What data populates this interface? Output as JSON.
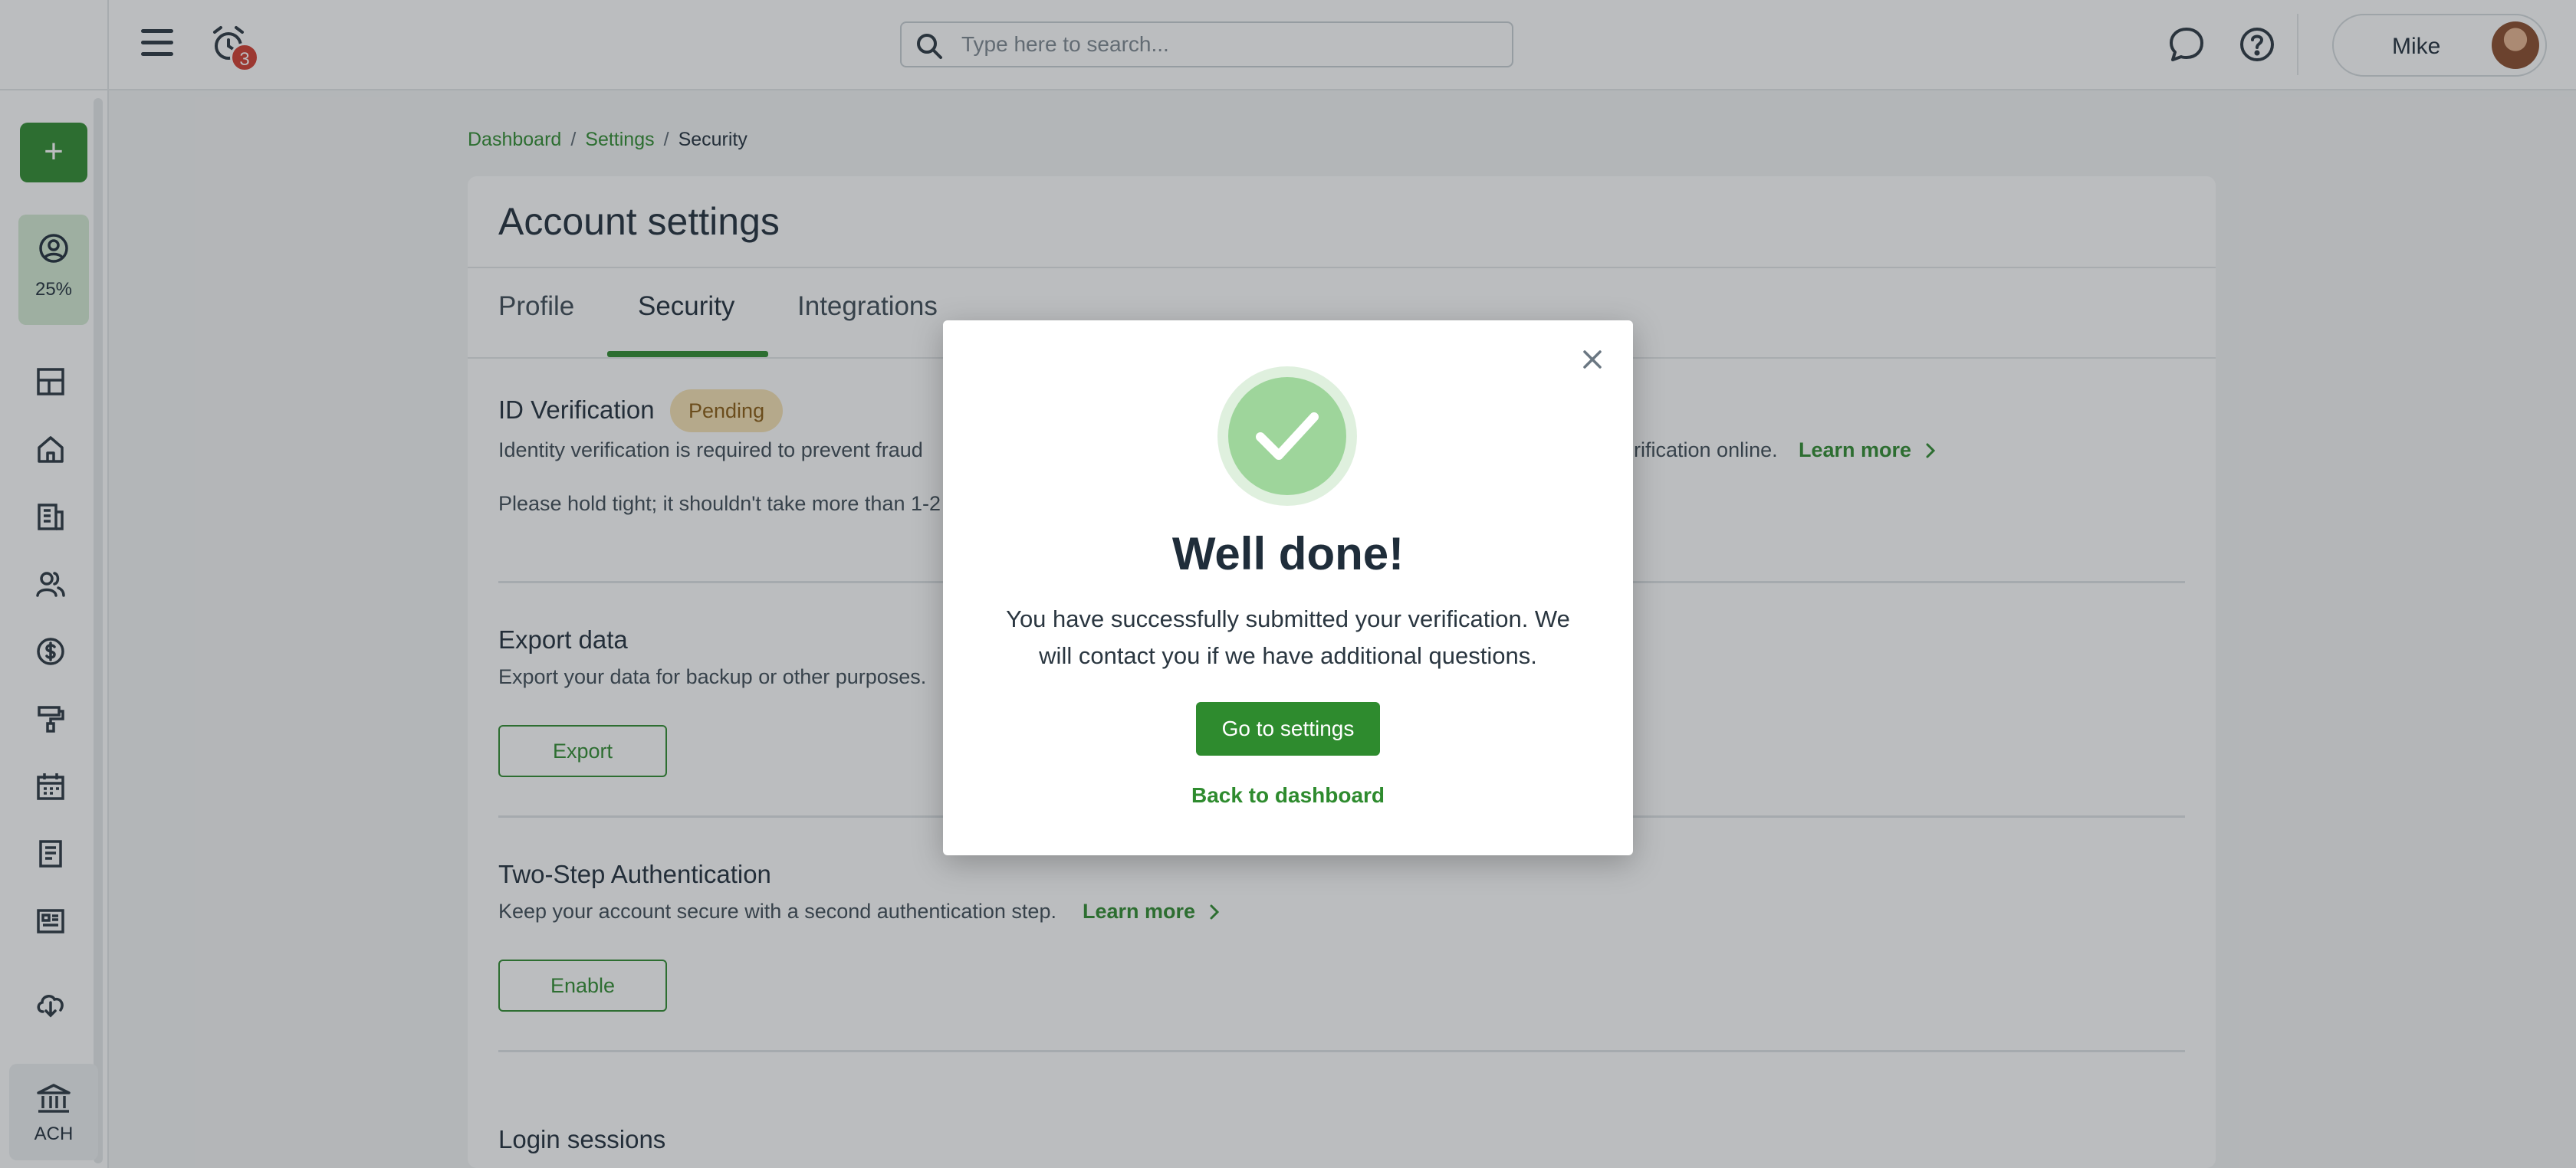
{
  "header": {
    "search_placeholder": "Type here to search...",
    "notification_count": "3",
    "user_name": "Mike"
  },
  "sidebar": {
    "new_button": "+",
    "progress_label": "25%",
    "progress_value": 0.25,
    "ach_label": "ACH",
    "icons": [
      "dashboard-icon",
      "home-icon",
      "properties-icon",
      "people-icon",
      "money-icon",
      "maintenance-icon",
      "calendar-icon",
      "document-icon",
      "report-icon",
      "download-icon",
      "bank-icon"
    ]
  },
  "breadcrumb": {
    "items": [
      "Dashboard",
      "Settings",
      "Security"
    ],
    "separator": "/"
  },
  "page": {
    "title": "Account settings",
    "tabs": [
      "Profile",
      "Security",
      "Integrations"
    ],
    "active_tab": "Security"
  },
  "sections": {
    "id_verification": {
      "title": "ID Verification",
      "status": "Pending",
      "text_left": "Identity verification is required to prevent fraud",
      "text_right": "erification online.",
      "learn_more": "Learn more",
      "hold_text": "Please hold tight; it shouldn't take more than 1-2"
    },
    "export": {
      "title": "Export data",
      "text": "Export your data for backup or other purposes.",
      "button": "Export"
    },
    "two_step": {
      "title": "Two-Step Authentication",
      "text": "Keep your account secure with a second authentication step.",
      "learn_more": "Learn more",
      "button": "Enable"
    },
    "login_sessions": {
      "title": "Login sessions"
    }
  },
  "modal": {
    "title": "Well done!",
    "message": "You have successfully submitted your verification. We will contact you if we have additional questions.",
    "primary_button": "Go to settings",
    "secondary_link": "Back to dashboard"
  },
  "colors": {
    "brand_green": "#2e8b2e",
    "pending_bg": "#f6e2b3",
    "badge_red": "#d13b2f"
  }
}
